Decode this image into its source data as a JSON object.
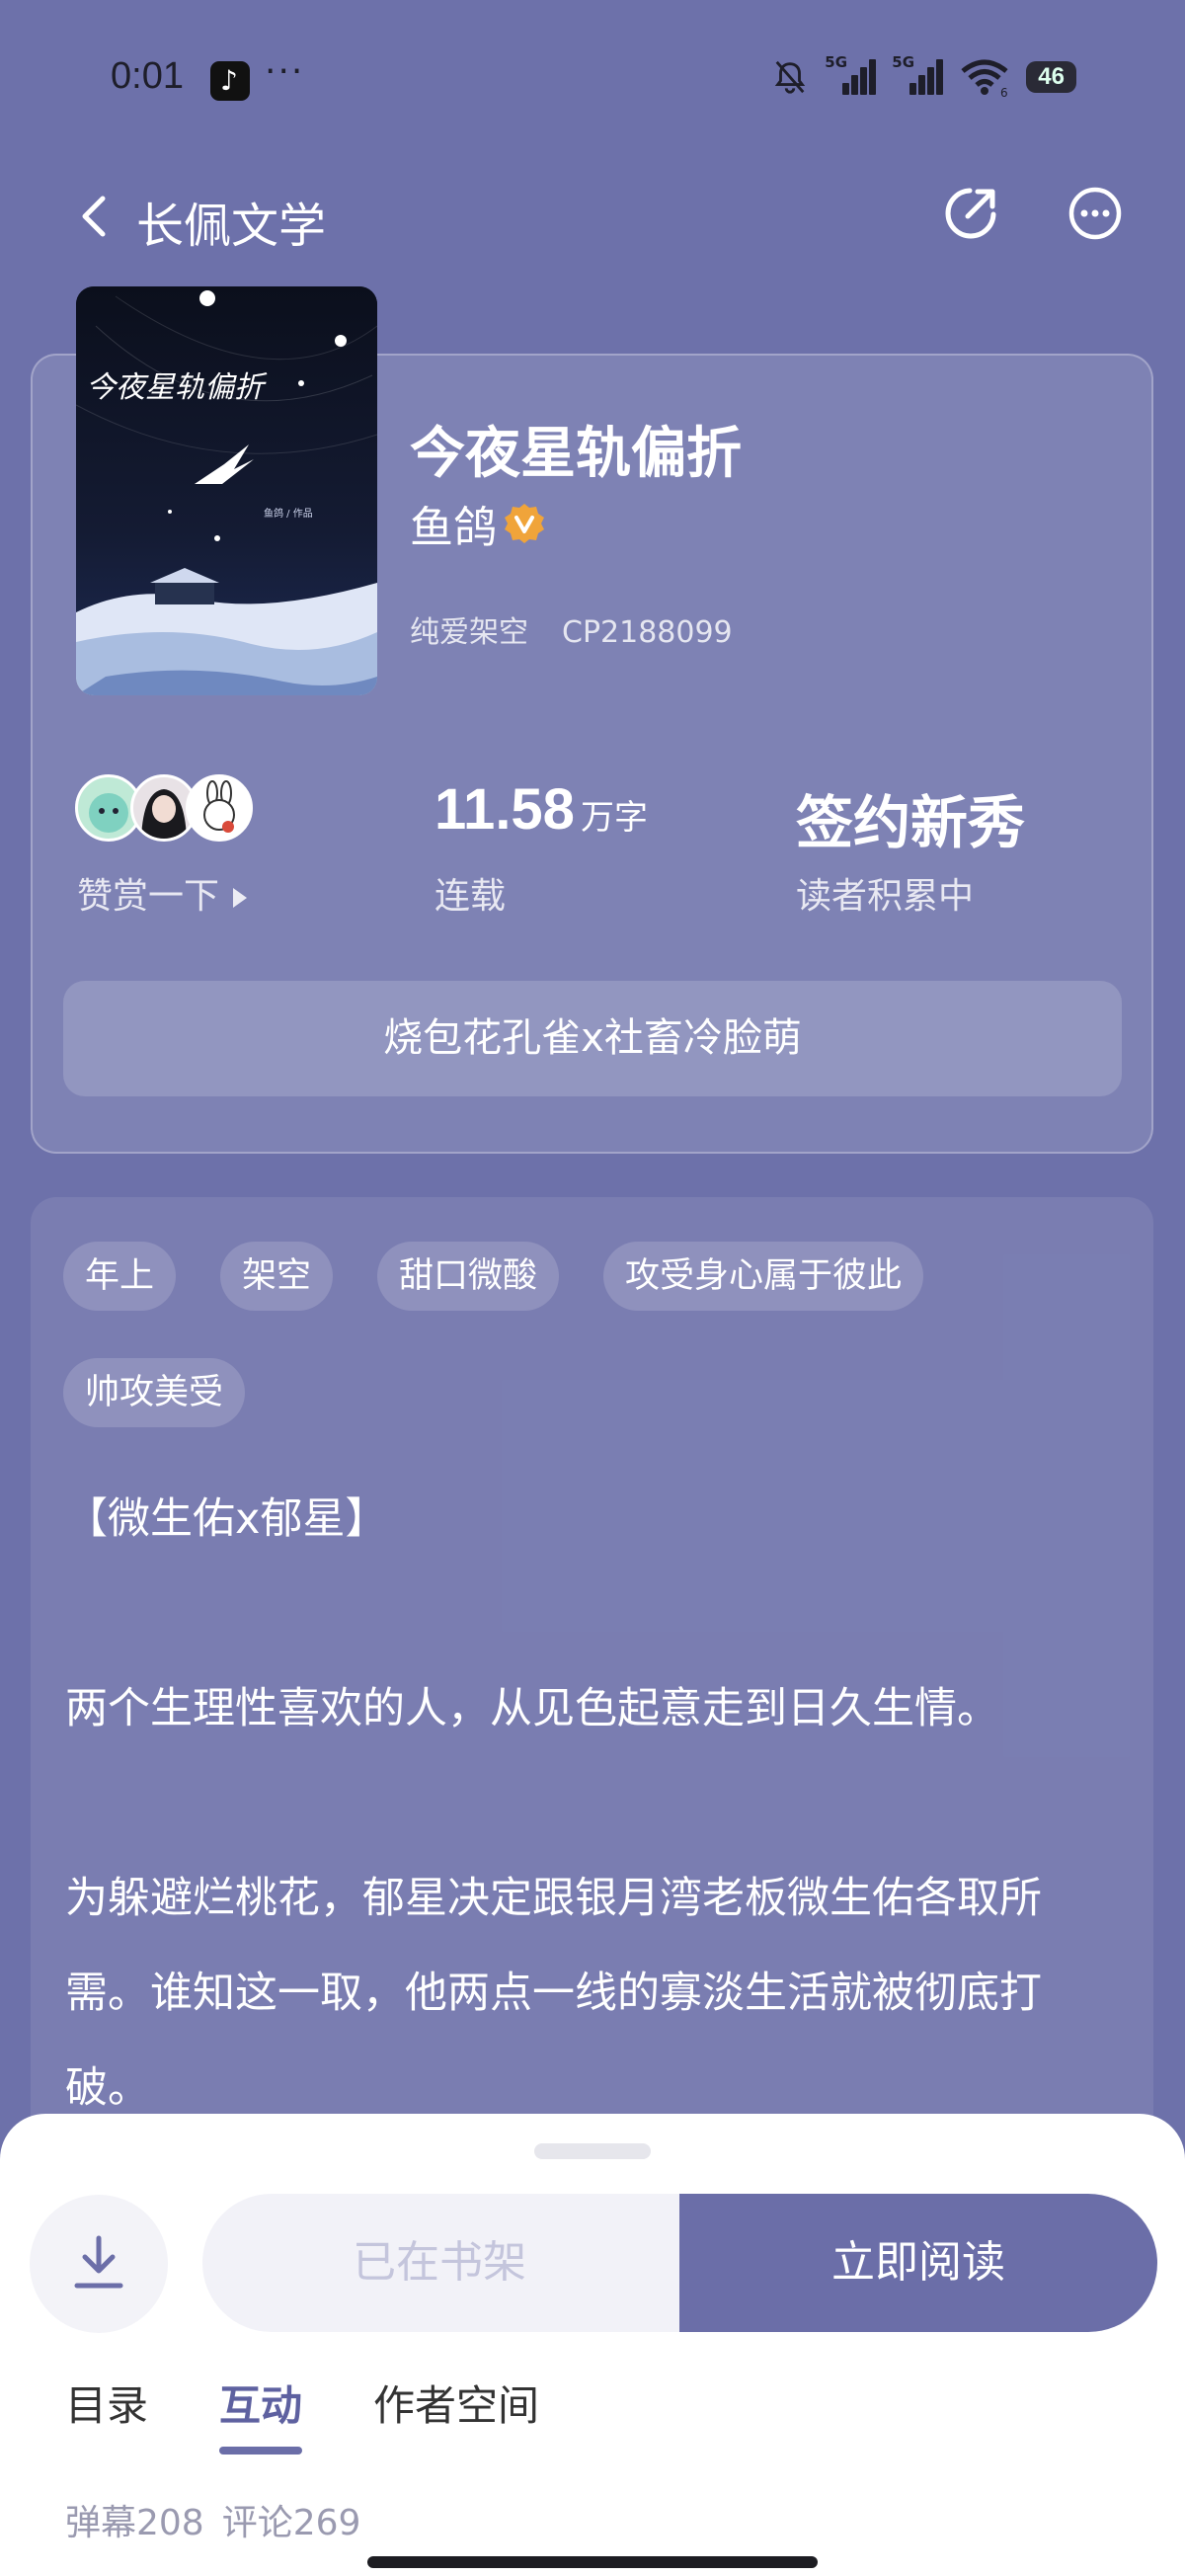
{
  "status_bar": {
    "time": "0:01",
    "dots": "···",
    "sim1": "5G",
    "sim2": "5G",
    "wifi": "6",
    "battery": "46"
  },
  "header": {
    "title": "长佩文学"
  },
  "book": {
    "title": "今夜星轨偏折",
    "author": "鱼鸽",
    "category": "纯爱架空",
    "cp_id": "CP2188099",
    "cover_title": "今夜星轨偏折",
    "cover_credit": "鱼鸽 / 作品"
  },
  "stats": {
    "reward_label": "赞赏一下",
    "word_count": "11.58",
    "word_unit": "万字",
    "serial_status": "连载",
    "level": "签约新秀",
    "level_sub": "读者积累中"
  },
  "tagline": "烧包花孔雀x社畜冷脸萌",
  "tags": [
    "年上",
    "架空",
    "甜口微酸",
    "攻受身心属于彼此",
    "帅攻美受"
  ],
  "description": {
    "line1": "【微生佑x郁星】",
    "line2": "两个生理性喜欢的人，从见色起意走到日久生情。",
    "line3": "为躲避烂桃花，郁星决定跟银月湾老板微生佑各取所需。谁知这一取，他两点一线的寡淡生活就被彻底打破。"
  },
  "actions": {
    "shelf_label": "已在书架",
    "read_label": "立即阅读"
  },
  "tabs": [
    {
      "label": "目录",
      "active": false
    },
    {
      "label": "互动",
      "active": true
    },
    {
      "label": "作者空间",
      "active": false
    }
  ],
  "counts": {
    "danmaku": "弹幕208",
    "comments": "评论269"
  },
  "colors": {
    "background": "#6d71aa",
    "accent": "#6b6ea8",
    "verified": "#f0a43a"
  }
}
